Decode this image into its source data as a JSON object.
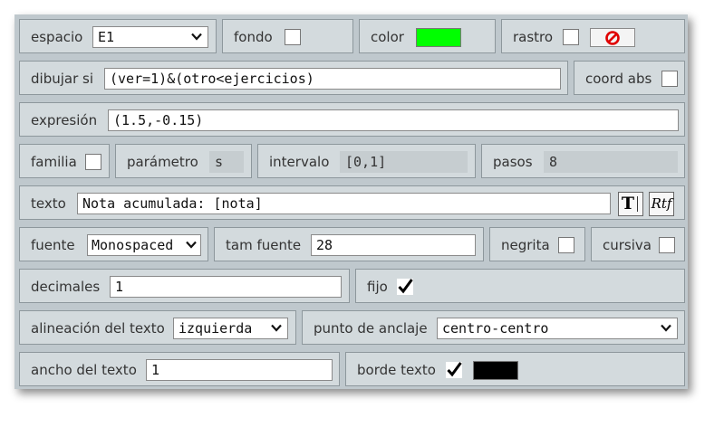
{
  "espacio": {
    "label": "espacio",
    "value": "E1"
  },
  "fondo": {
    "label": "fondo",
    "checked": false
  },
  "color": {
    "label": "color",
    "value": "#00ff00"
  },
  "rastro": {
    "label": "rastro",
    "checked": false,
    "button_icon": "prohibited-icon",
    "icon_color": "#e00000"
  },
  "dibujar_si": {
    "label": "dibujar si",
    "value": "(ver=1)&(otro<ejercicios)"
  },
  "coord_abs": {
    "label": "coord abs",
    "checked": false
  },
  "expresion": {
    "label": "expresión",
    "value": "(1.5,-0.15)"
  },
  "familia": {
    "label": "familia",
    "checked": false
  },
  "parametro": {
    "label": "parámetro",
    "value": "s"
  },
  "intervalo": {
    "label": "intervalo",
    "value": "[0,1]"
  },
  "pasos": {
    "label": "pasos",
    "value": "8"
  },
  "texto": {
    "label": "texto",
    "value": "Nota acumulada: [nota]",
    "text_button_icon": "text-editor-icon",
    "rtf_button_label": "Rtf"
  },
  "fuente": {
    "label": "fuente",
    "value": "Monospaced"
  },
  "tam_fuente": {
    "label": "tam fuente",
    "value": "28"
  },
  "negrita": {
    "label": "negrita",
    "checked": false
  },
  "cursiva": {
    "label": "cursiva",
    "checked": false
  },
  "decimales": {
    "label": "decimales",
    "value": "1"
  },
  "fijo": {
    "label": "fijo",
    "checked": true
  },
  "alineacion": {
    "label": "alineación del texto",
    "value": "izquierda"
  },
  "punto_anclaje": {
    "label": "punto de anclaje",
    "value": "centro-centro"
  },
  "ancho_texto": {
    "label": "ancho del texto",
    "value": "1"
  },
  "borde_texto": {
    "label": "borde texto",
    "checked": true,
    "color": "#000000"
  }
}
